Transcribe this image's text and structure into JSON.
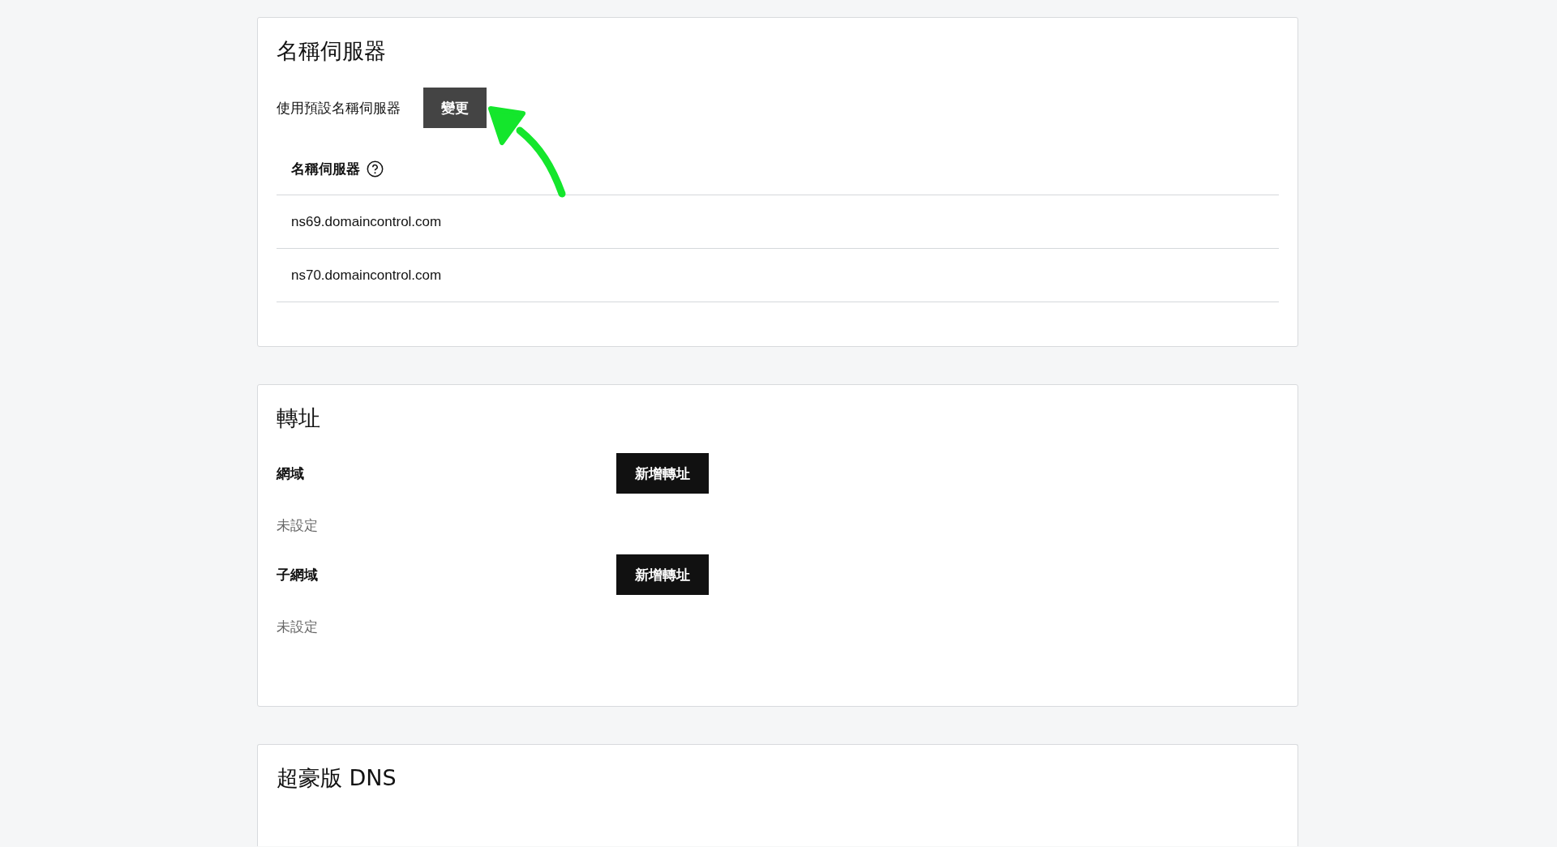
{
  "nameservers": {
    "title": "名稱伺服器",
    "mode_label": "使用預設名稱伺服器",
    "change_button": "變更",
    "table": {
      "column_1": "名稱伺服器",
      "rows": [
        "ns69.domaincontrol.com",
        "ns70.domaincontrol.com"
      ]
    }
  },
  "forwarding": {
    "title": "轉址",
    "sections": [
      {
        "label": "網域",
        "button": "新增轉址",
        "status": "未設定"
      },
      {
        "label": "子網域",
        "button": "新增轉址",
        "status": "未設定"
      }
    ]
  },
  "premium_dns": {
    "title": "超豪版 DNS"
  }
}
